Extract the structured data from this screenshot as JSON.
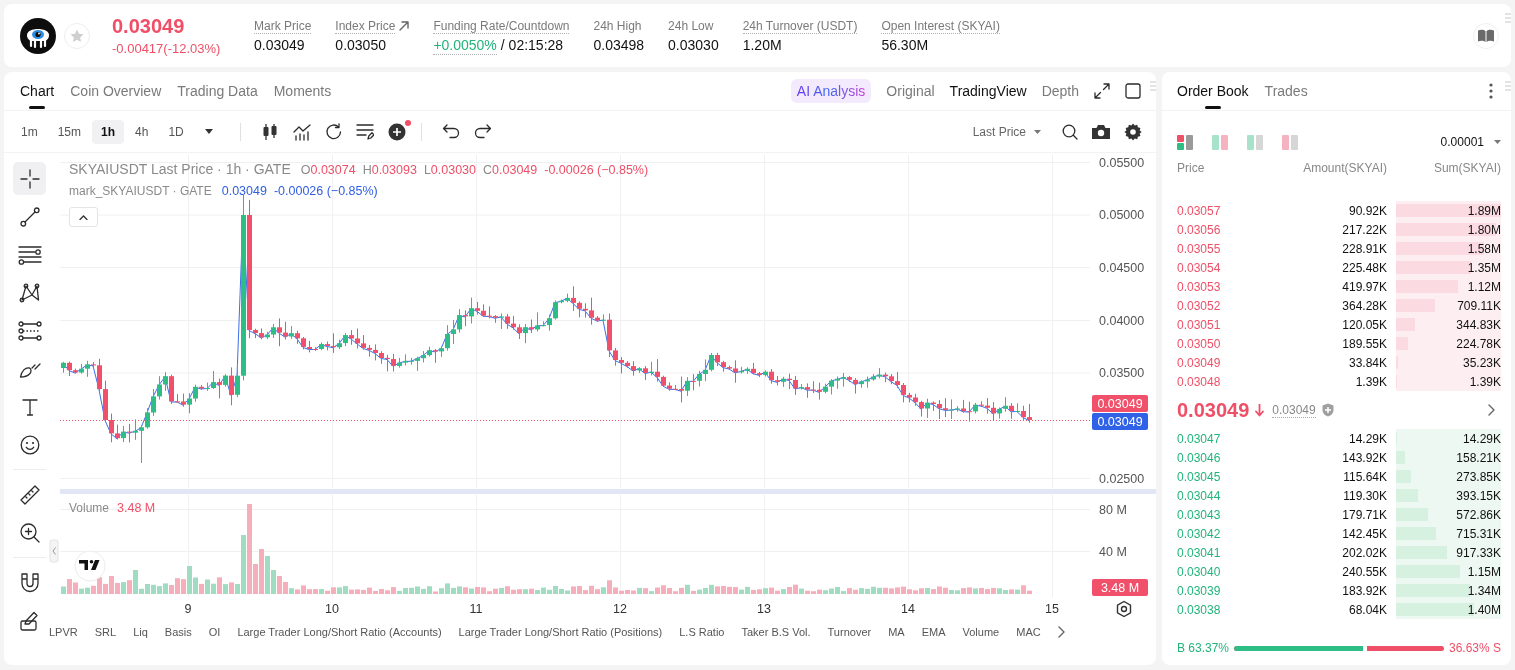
{
  "header": {
    "price": "0.03049",
    "change": "-0.00417(-12.03%)",
    "falling": true,
    "stats": [
      {
        "label": "Mark Price",
        "dotted": true,
        "value": "0.03049"
      },
      {
        "label": "Index Price",
        "dotted": true,
        "external": true,
        "value": "0.03050"
      },
      {
        "label": "Funding Rate/Countdown",
        "dotted": true,
        "rate": "+0.0050%",
        "positive": true,
        "countdown": "/ 02:15:28"
      },
      {
        "label": "24h High",
        "dotted": false,
        "value": "0.03498"
      },
      {
        "label": "24h Low",
        "dotted": false,
        "value": "0.03030"
      },
      {
        "label": "24h Turnover (USDT)",
        "dotted": true,
        "value": "1.20M"
      },
      {
        "label": "Open Interest (SKYAI)",
        "dotted": true,
        "value": "56.30M"
      }
    ]
  },
  "chart_panel": {
    "tabs": [
      {
        "label": "Chart",
        "selected": true
      },
      {
        "label": "Coin Overview",
        "selected": false
      },
      {
        "label": "Trading Data",
        "selected": false
      },
      {
        "label": "Moments",
        "selected": false
      }
    ],
    "views": [
      {
        "label": "AI Analysis",
        "kind": "ai",
        "selected": false
      },
      {
        "label": "Original",
        "kind": "plain",
        "selected": false
      },
      {
        "label": "TradingView",
        "kind": "plain",
        "selected": true
      },
      {
        "label": "Depth",
        "kind": "plain",
        "selected": false
      }
    ],
    "intervals": [
      {
        "label": "1m",
        "selected": false
      },
      {
        "label": "15m",
        "selected": false
      },
      {
        "label": "1h",
        "selected": true
      },
      {
        "label": "4h",
        "selected": false
      },
      {
        "label": "1D",
        "selected": false
      }
    ],
    "price_source": "Last Price",
    "tools": [
      {
        "selected": true
      },
      {
        "selected": false
      },
      {
        "selected": false
      },
      {
        "selected": false
      },
      {
        "selected": false
      },
      {
        "selected": false
      },
      {
        "selected": false
      },
      {
        "selected": false
      },
      {
        "selected": false
      },
      {
        "selected": false
      },
      {
        "selected": false
      },
      {
        "selected": false
      }
    ],
    "legend": {
      "title": "SKYAIUSDT Last Price · 1h · GATE",
      "ohlc": [
        {
          "key": "O",
          "value": "0.03074"
        },
        {
          "key": "H",
          "value": "0.03093"
        },
        {
          "key": "L",
          "value": "0.03030"
        },
        {
          "key": "C",
          "value": "0.03049"
        }
      ],
      "change": "-0.00026 (−0.85%)"
    },
    "mark_legend": {
      "title": "mark_SKYAIUSDT · GATE",
      "value": "0.03049",
      "change": "-0.00026 (−0.85%)"
    },
    "price_axis": [
      "0.05500",
      "0.05000",
      "0.04500",
      "0.04000",
      "0.03500",
      "0.02500"
    ],
    "last_price_label": "0.03049",
    "mark_price_label": "0.03049",
    "volume_legend": {
      "title": "Volume",
      "value": "3.48 M"
    },
    "volume_axis": [
      "80 M",
      "40 M"
    ],
    "volume_label": "3.48 M",
    "time_axis": [
      "9",
      "10",
      "11",
      "12",
      "13",
      "14",
      "15"
    ],
    "indicators": [
      "LPVR",
      "SRL",
      "Liq",
      "Basis",
      "OI",
      "Large Trader Long/Short Ratio (Accounts)",
      "Large Trader Long/Short Ratio (Positions)",
      "L.S Ratio",
      "Taker B.S Vol.",
      "Turnover",
      "MA",
      "EMA",
      "Volume",
      "MAC"
    ]
  },
  "order_book": {
    "tabs": [
      {
        "label": "Order Book",
        "selected": true
      },
      {
        "label": "Trades",
        "selected": false
      }
    ],
    "layouts": [
      {
        "kind": "stacked",
        "selected": true
      },
      {
        "kind": "split",
        "selected": false
      },
      {
        "kind": "bids",
        "selected": false
      },
      {
        "kind": "asks",
        "selected": false
      }
    ],
    "precision": "0.00001",
    "columns": [
      "Price",
      "Amount(SKYAI)",
      "Sum(SKYAI)"
    ],
    "asks": [
      {
        "price": "0.03057",
        "amount": "90.92K",
        "sum": "1.89M",
        "level": 1.0
      },
      {
        "price": "0.03056",
        "amount": "217.22K",
        "sum": "1.80M",
        "level": 0.952
      },
      {
        "price": "0.03055",
        "amount": "228.91K",
        "sum": "1.58M",
        "level": 0.836
      },
      {
        "price": "0.03054",
        "amount": "225.48K",
        "sum": "1.35M",
        "level": 0.714
      },
      {
        "price": "0.03053",
        "amount": "419.97K",
        "sum": "1.12M",
        "level": 0.593
      },
      {
        "price": "0.03052",
        "amount": "364.28K",
        "sum": "709.11K",
        "level": 0.375
      },
      {
        "price": "0.03051",
        "amount": "120.05K",
        "sum": "344.83K",
        "level": 0.182
      },
      {
        "price": "0.03050",
        "amount": "189.55K",
        "sum": "224.78K",
        "level": 0.119
      },
      {
        "price": "0.03049",
        "amount": "33.84K",
        "sum": "35.23K",
        "level": 0.019
      },
      {
        "price": "0.03048",
        "amount": "1.39K",
        "sum": "1.39K",
        "level": 0.001
      }
    ],
    "last_price": "0.03049",
    "falling": true,
    "mark_price": "0.03049",
    "bids": [
      {
        "price": "0.03047",
        "amount": "14.29K",
        "sum": "14.29K",
        "level": 0.008
      },
      {
        "price": "0.03046",
        "amount": "143.92K",
        "sum": "158.21K",
        "level": 0.084
      },
      {
        "price": "0.03045",
        "amount": "115.64K",
        "sum": "273.85K",
        "level": 0.145
      },
      {
        "price": "0.03044",
        "amount": "119.30K",
        "sum": "393.15K",
        "level": 0.208
      },
      {
        "price": "0.03043",
        "amount": "179.71K",
        "sum": "572.86K",
        "level": 0.303
      },
      {
        "price": "0.03042",
        "amount": "142.45K",
        "sum": "715.31K",
        "level": 0.378
      },
      {
        "price": "0.03041",
        "amount": "202.02K",
        "sum": "917.33K",
        "level": 0.485
      },
      {
        "price": "0.03040",
        "amount": "240.55K",
        "sum": "1.15M",
        "level": 0.608
      },
      {
        "price": "0.03039",
        "amount": "183.92K",
        "sum": "1.34M",
        "level": 0.709
      },
      {
        "price": "0.03038",
        "amount": "68.04K",
        "sum": "1.40M",
        "level": 0.741
      }
    ],
    "ratio": {
      "buy": "B 63.37%",
      "sell": "36.63% S",
      "level": 0.6337
    }
  }
}
